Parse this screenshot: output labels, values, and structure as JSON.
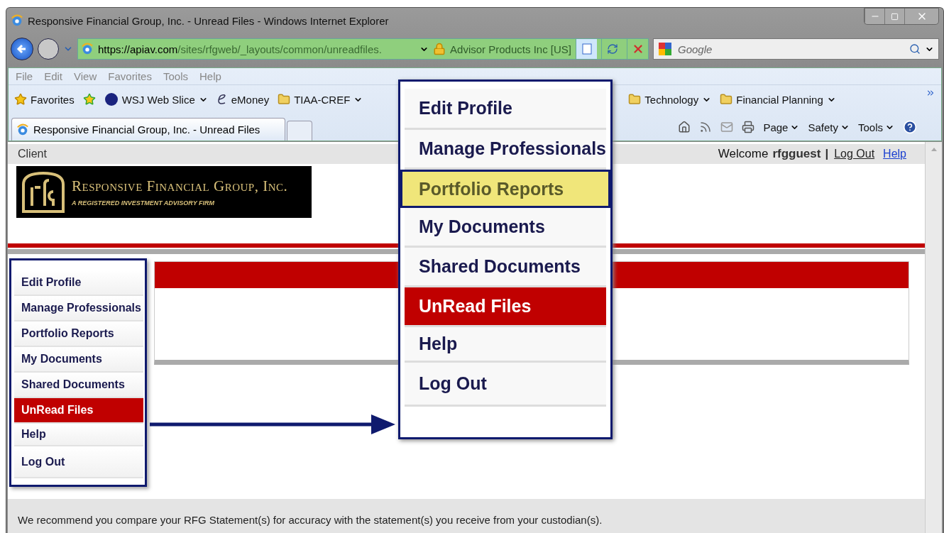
{
  "window": {
    "title": "Responsive Financial Group, Inc. - Unread Files - Windows Internet Explorer"
  },
  "address_bar": {
    "url_host": "https://apiav.com",
    "url_path": "/sites/rfgweb/_layouts/common/unreadfiles.",
    "certificate": "Advisor Products Inc [US]"
  },
  "search": {
    "placeholder": "Google"
  },
  "menu_bar": [
    "File",
    "Edit",
    "View",
    "Favorites",
    "Tools",
    "Help"
  ],
  "favorites_bar": [
    {
      "label": "Favorites",
      "kind": "star",
      "dropdown": false
    },
    {
      "label": "WSJ Web Slice",
      "kind": "webslice",
      "dropdown": true
    },
    {
      "label": "eMoney",
      "kind": "link",
      "dropdown": false
    },
    {
      "label": "TIAA-CREF",
      "kind": "folder",
      "dropdown": true
    },
    {
      "label": "Technology",
      "kind": "folder",
      "dropdown": true
    },
    {
      "label": "Financial Planning",
      "kind": "folder",
      "dropdown": true
    }
  ],
  "tab": {
    "title": "Responsive Financial Group, Inc. - Unread Files"
  },
  "command_bar": [
    "Page",
    "Safety",
    "Tools"
  ],
  "page": {
    "section": "Client",
    "welcome": "Welcome",
    "user": "rfgguest",
    "separator": "|",
    "links": [
      "Log Out",
      "Help"
    ],
    "logo": {
      "name": "Responsive Financial Group, Inc.",
      "tagline": "A REGISTERED INVESTMENT ADVISORY FIRM"
    },
    "sidebar": [
      {
        "label": "Edit Profile",
        "selected": false
      },
      {
        "label": "Manage Professionals",
        "selected": false
      },
      {
        "label": "Portfolio Reports",
        "selected": false
      },
      {
        "label": "My Documents",
        "selected": false
      },
      {
        "label": "Shared Documents",
        "selected": false
      },
      {
        "label": "UnRead Files",
        "selected": true
      },
      {
        "label": "Help",
        "selected": false
      },
      {
        "label": "Log Out",
        "selected": false
      }
    ],
    "notice": "We recommend you compare your RFG Statement(s) for accuracy with the statement(s) you receive from your custodian(s)."
  },
  "callout": [
    {
      "label": "Edit Profile",
      "selected": false,
      "highlighted": false
    },
    {
      "label": "Manage Professionals",
      "selected": false,
      "highlighted": false
    },
    {
      "label": "Portfolio Reports",
      "selected": false,
      "highlighted": true
    },
    {
      "label": "My Documents",
      "selected": false,
      "highlighted": false
    },
    {
      "label": "Shared Documents",
      "selected": false,
      "highlighted": false
    },
    {
      "label": "UnRead Files",
      "selected": true,
      "highlighted": false
    },
    {
      "label": "Help",
      "selected": false,
      "highlighted": false
    },
    {
      "label": "Log Out",
      "selected": false,
      "highlighted": false
    }
  ]
}
